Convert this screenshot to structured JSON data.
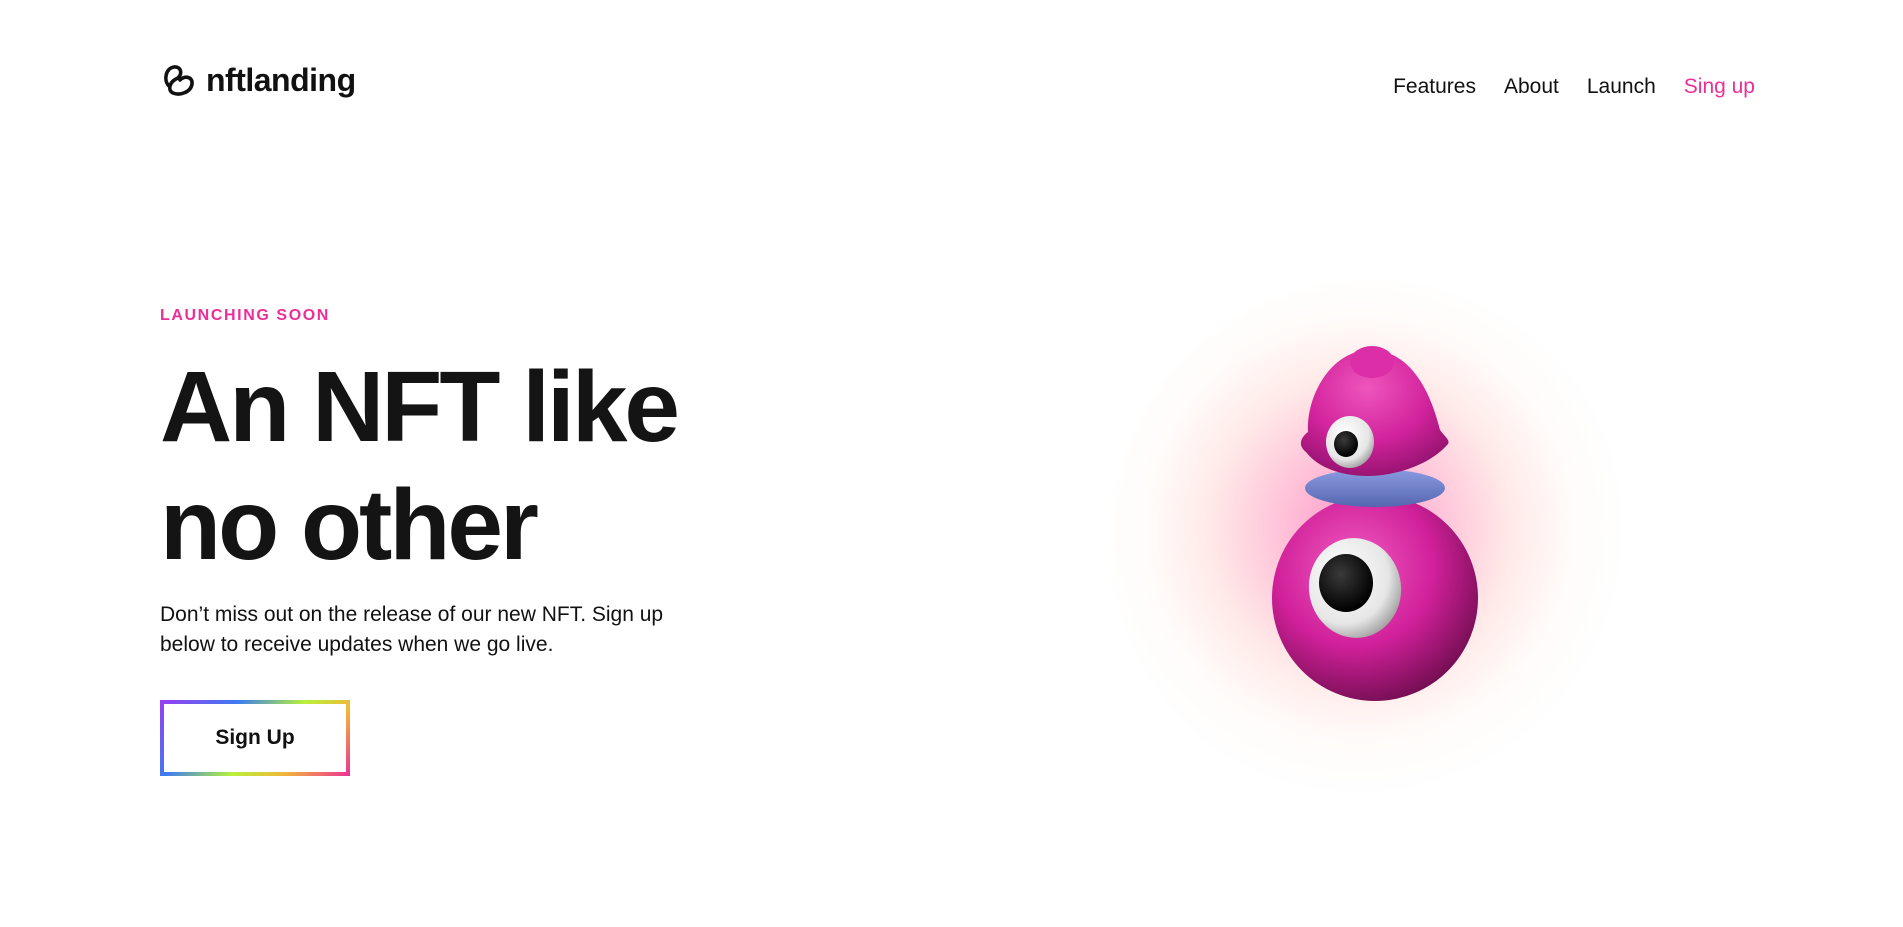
{
  "brand": {
    "name": "nftlanding",
    "logo_icon": "swirl-logo-icon"
  },
  "nav": {
    "items": [
      {
        "label": "Features"
      },
      {
        "label": "About"
      },
      {
        "label": "Launch"
      },
      {
        "label": "Sing up",
        "accent": true
      }
    ]
  },
  "hero": {
    "eyebrow": "LAUNCHING SOON",
    "headline_line1": "An NFT like",
    "headline_line2": "no other",
    "description": "Don’t miss out on the release of our new NFT. Sign up below to receive updates when we go live.",
    "cta_label": "Sign Up",
    "illustration": "pink-one-eyed-nft-character"
  },
  "colors": {
    "accent": "#ec2f98",
    "text": "#141414",
    "background": "#ffffff",
    "character_body": "#d6259c",
    "character_collar": "#6f82c9"
  }
}
